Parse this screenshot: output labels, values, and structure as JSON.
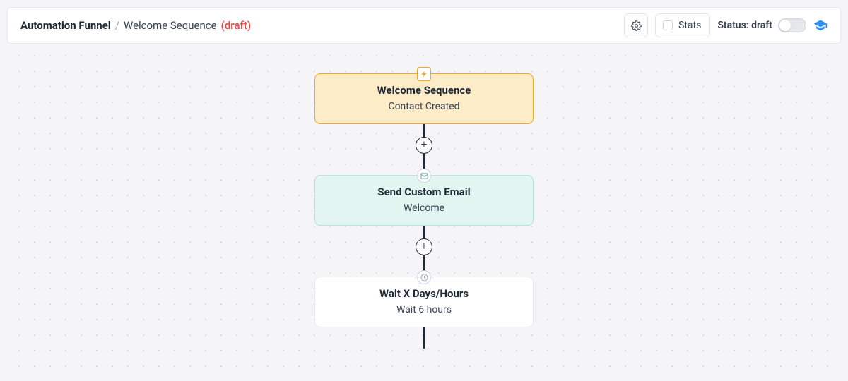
{
  "header": {
    "breadcrumb_root": "Automation Funnel",
    "breadcrumb_name": "Welcome Sequence",
    "breadcrumb_draft": "(draft)",
    "stats_label": "Stats",
    "status_label": "Status: draft"
  },
  "nodes": {
    "trigger": {
      "title": "Welcome Sequence",
      "subtitle": "Contact Created"
    },
    "email": {
      "title": "Send Custom Email",
      "subtitle": "Welcome"
    },
    "wait": {
      "title": "Wait X Days/Hours",
      "subtitle": "Wait 6 hours"
    }
  }
}
